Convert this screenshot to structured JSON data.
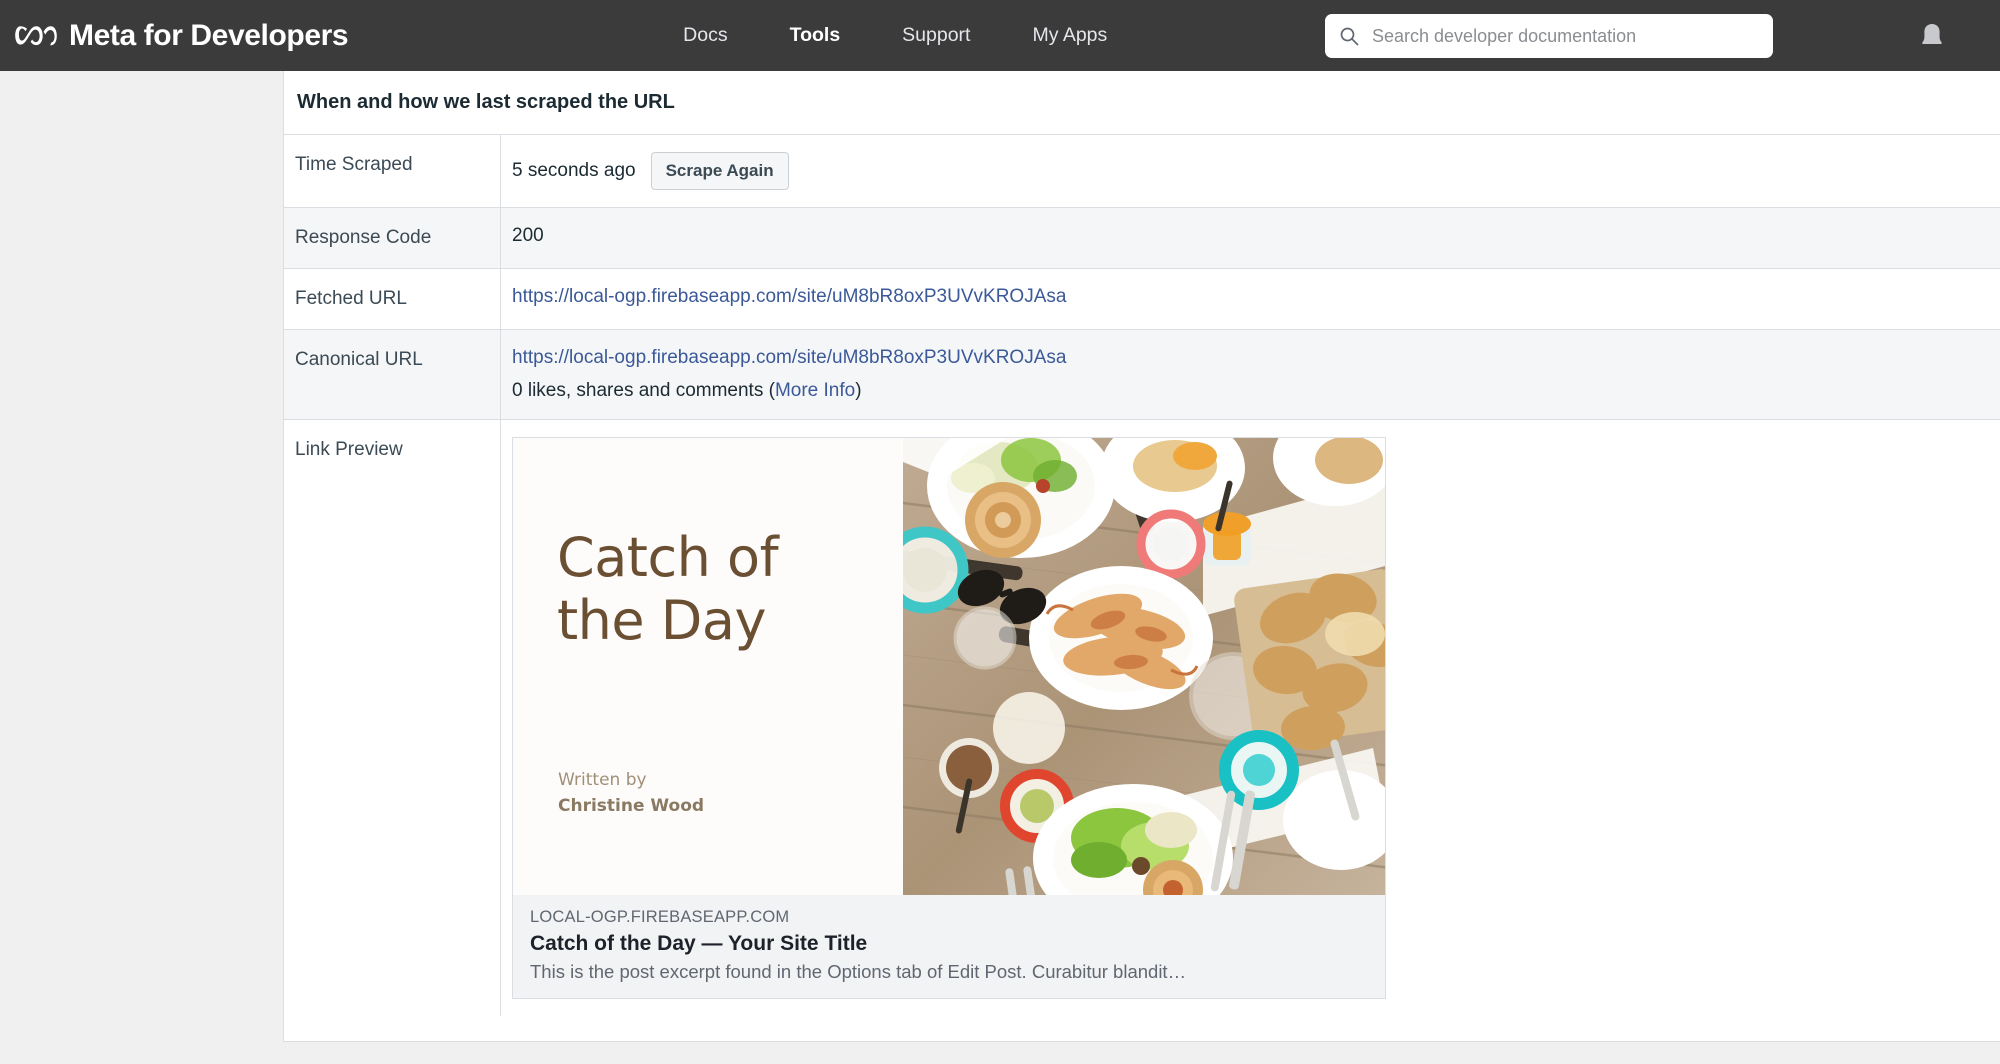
{
  "topbar": {
    "brand": "Meta for Developers",
    "logo_icon": "meta-infinity-logo",
    "nav": [
      {
        "label": "Docs",
        "active": false
      },
      {
        "label": "Tools",
        "active": true
      },
      {
        "label": "Support",
        "active": false
      },
      {
        "label": "My Apps",
        "active": false
      }
    ],
    "search": {
      "icon": "search-icon",
      "placeholder": "Search developer documentation",
      "value": ""
    },
    "notifications_icon": "bell-icon",
    "background_color": "#3b3b3b"
  },
  "panel": {
    "title": "When and how we last scraped the URL",
    "rows": {
      "time_scraped": {
        "label": "Time Scraped",
        "value": "5 seconds ago",
        "button_label": "Scrape Again"
      },
      "response_code": {
        "label": "Response Code",
        "value": "200"
      },
      "fetched_url": {
        "label": "Fetched URL",
        "value": "https://local-ogp.firebaseapp.com/site/uM8bR8oxP3UVvKROJAsa"
      },
      "canonical_url": {
        "label": "Canonical URL",
        "value": "https://local-ogp.firebaseapp.com/site/uM8bR8oxP3UVvKROJAsa",
        "engagement_prefix": "0 likes, shares and comments (",
        "engagement_link": "More Info",
        "engagement_suffix": ")"
      },
      "link_preview": {
        "label": "Link Preview",
        "image": {
          "headline_line1": "Catch of",
          "headline_line2": "the Day",
          "byline_label": "Written by",
          "byline_author": "Christine Wood",
          "photo_description": "overhead-food-table-photo"
        },
        "card": {
          "domain": "LOCAL-OGP.FIREBASEAPP.COM",
          "title": "Catch of the Day — Your Site Title",
          "description": "This is the post excerpt found in the Options tab of Edit Post. Curabitur blandit…"
        }
      }
    }
  },
  "colors": {
    "link": "#3b5998",
    "nav_bg": "#3b3b3b",
    "shaded_row": "#f5f6f7",
    "border": "#dadde1",
    "headline_brown": "#6b4f33"
  }
}
